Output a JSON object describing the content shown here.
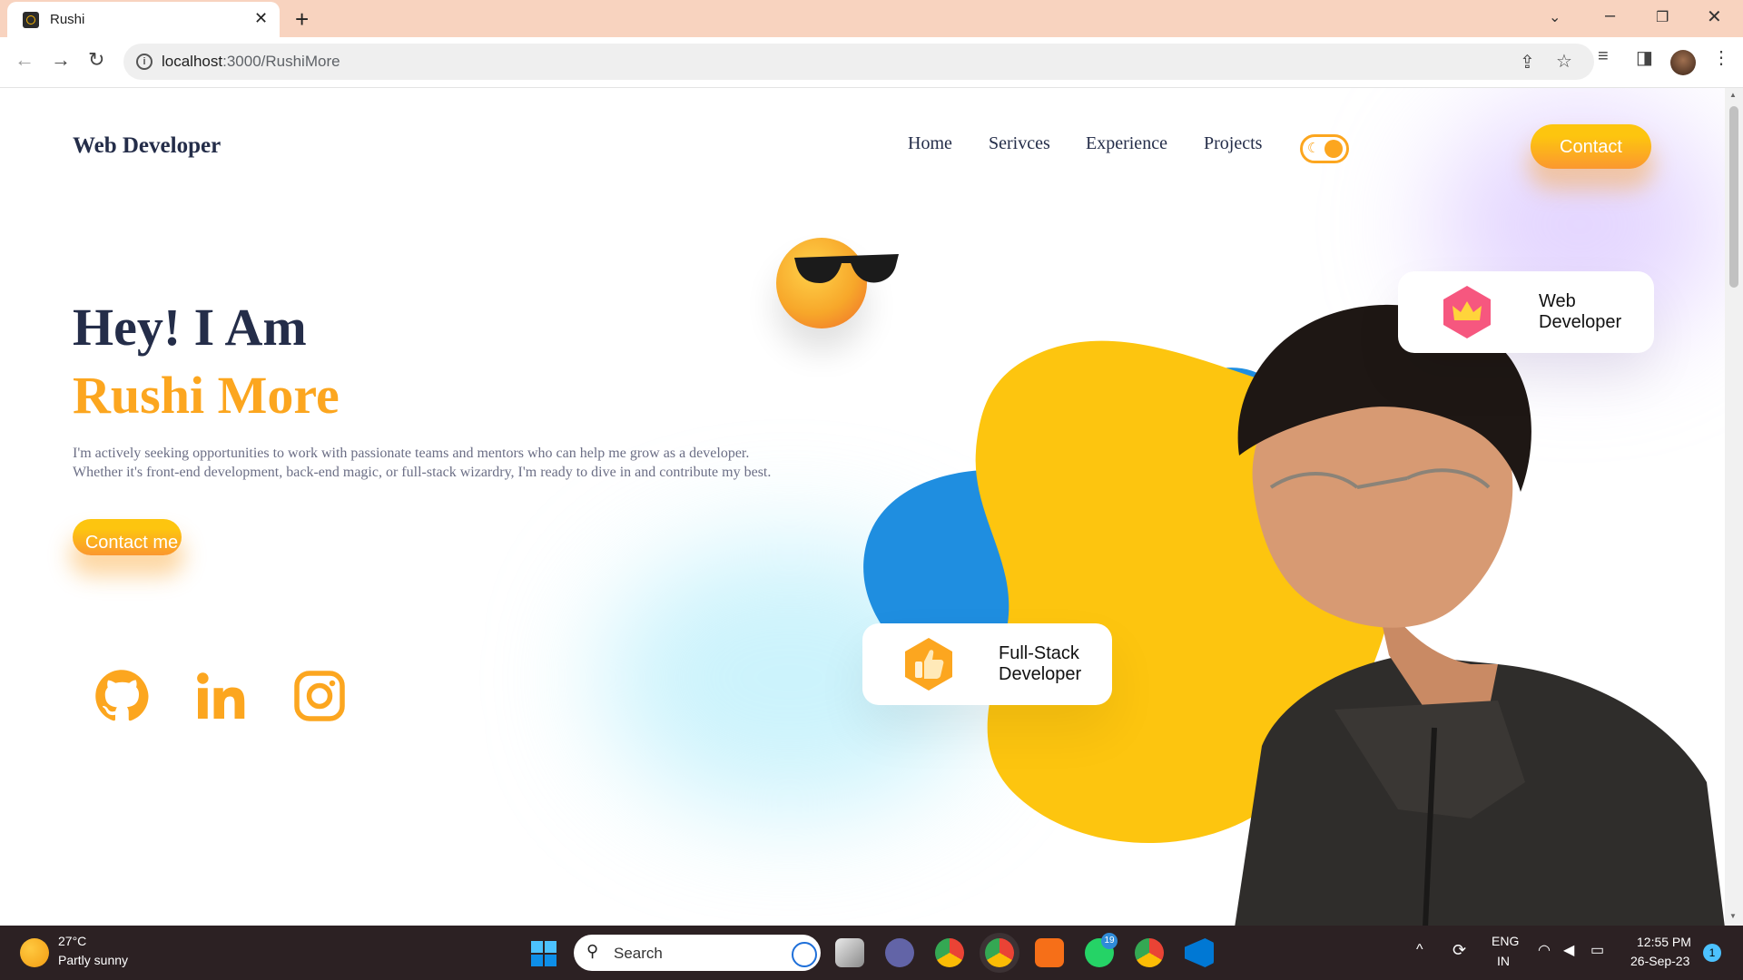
{
  "browser": {
    "tab_title": "Rushi",
    "url_host": "localhost",
    "url_rest": ":3000/RushiMore"
  },
  "nav": {
    "logo": "Web Developer",
    "links": [
      "Home",
      "Serivces",
      "Experience",
      "Projects"
    ],
    "contact": "Contact"
  },
  "hero": {
    "greeting": "Hey! I Am",
    "name": "Rushi More",
    "description_line1": "I'm actively seeking opportunities to work with passionate teams and mentors who can help me grow as a developer.",
    "description_line2": "Whether it's front-end development, back-end magic, or full-stack wizardry, I'm ready to dive in and contribute my best.",
    "contact_button": "Contact me"
  },
  "social_icons": [
    "github-icon",
    "linkedin-icon",
    "instagram-icon"
  ],
  "cards": {
    "web": {
      "line1": "Web",
      "line2": "Developer",
      "icon": "crown-icon"
    },
    "fullstack": {
      "line1": "Full-Stack",
      "line2": "Developer",
      "icon": "thumbs-up-icon"
    }
  },
  "colors": {
    "accent": "#fca61f",
    "heading": "#242d49",
    "blob_yellow": "#fdc50f",
    "blob_blue": "#1f8ee0"
  },
  "taskbar": {
    "weather_temp": "27°C",
    "weather_desc": "Partly sunny",
    "search_placeholder": "Search",
    "whatsapp_badge": "19",
    "language_1": "ENG",
    "language_2": "IN",
    "time": "12:55 PM",
    "date": "26-Sep-23",
    "notification_count": "1"
  }
}
